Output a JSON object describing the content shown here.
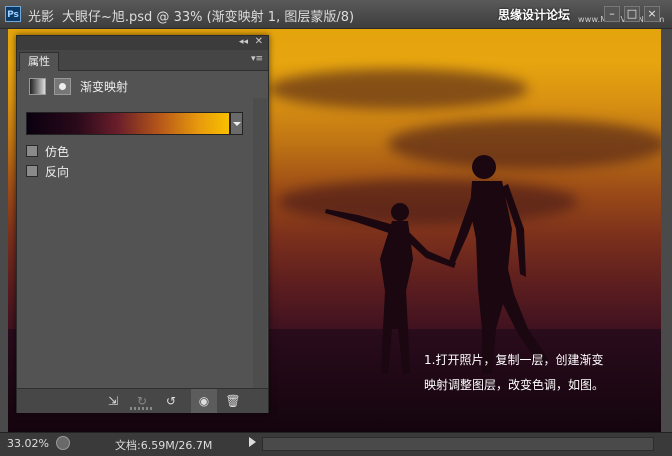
{
  "window": {
    "app_name": "光影",
    "doc_title": "大眼仔~旭.psd @ 33% (渐变映射 1, 图层蒙版/8)",
    "watermark": "思缘设计论坛",
    "watermark_url": "www.MISSVUAN.com",
    "buttons": [
      "–",
      "□",
      "×"
    ]
  },
  "panel": {
    "tab_label": "属性",
    "adjustment_title": "渐变映射",
    "options": [
      {
        "label": "仿色",
        "checked": false
      },
      {
        "label": "反向",
        "checked": false
      }
    ],
    "gradient_colors": [
      "#0a0010",
      "#6a1e2a",
      "#e89a0c",
      "#f8c000"
    ]
  },
  "canvas": {
    "caption_line1": "1.打开照片，复制一层，创建渐变",
    "caption_line2": "映射调整图层，改变色调，如图。"
  },
  "status": {
    "zoom": "33.02%",
    "doc_size": "文档:6.59M/26.7M"
  }
}
